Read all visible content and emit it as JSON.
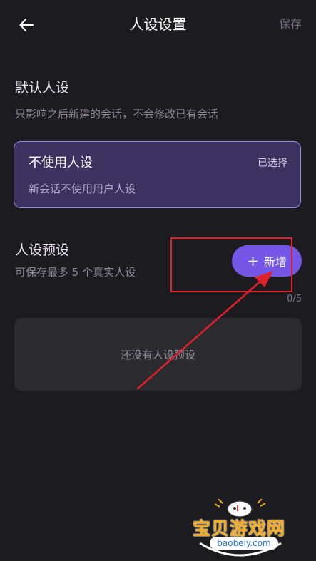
{
  "header": {
    "title": "人设设置",
    "save_label": "保存",
    "back_icon": "arrow-left-icon"
  },
  "default_section": {
    "title": "默认人设",
    "subtitle": "只影响之后新建的会话，不会修改已有会话",
    "card": {
      "title": "不使用人设",
      "status": "已选择",
      "description": "新会话不使用用户人设"
    }
  },
  "preset_section": {
    "title": "人设预设",
    "subtitle": "可保存最多 5 个真实人设",
    "add_button_label": "新增",
    "add_icon": "plus-icon",
    "counter": "0/5",
    "empty_text": "还没有人设预设"
  },
  "watermark": {
    "brand": "宝贝游戏网",
    "url": "baobeiy.com"
  },
  "colors": {
    "background": "#1c1b1f",
    "accent": "#7457e6",
    "selected_card": "#3b325f",
    "selected_border": "#9b8ce6",
    "annotation": "#e0202a"
  }
}
